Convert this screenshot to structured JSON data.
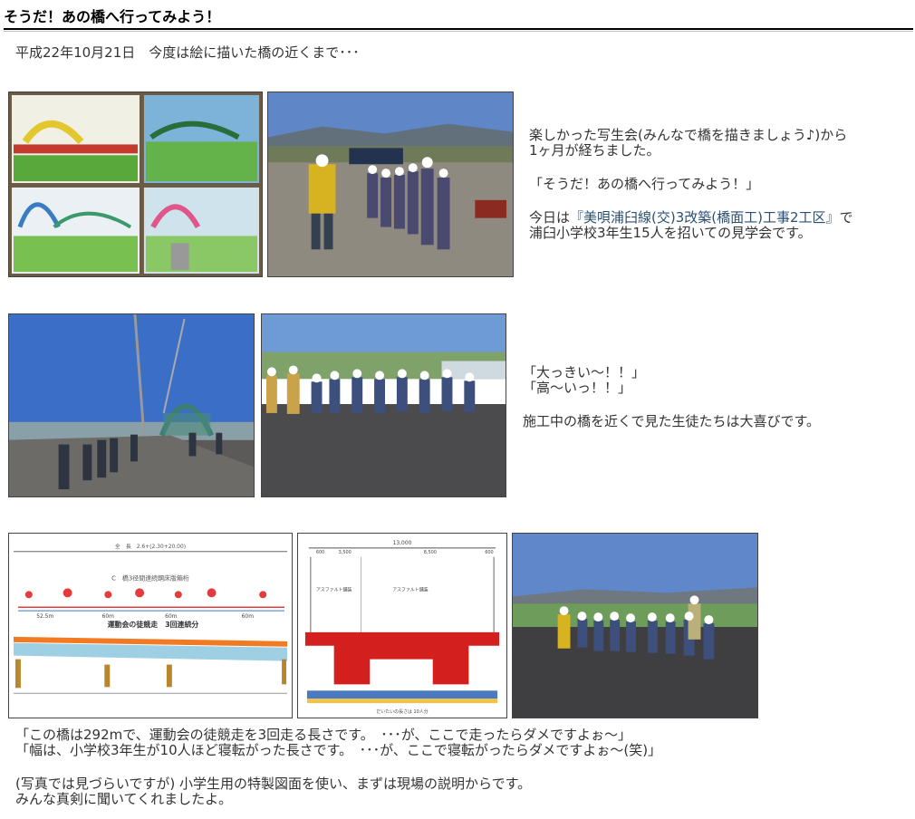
{
  "header": {
    "title": "そうだ！あの橋へ行ってみよう！"
  },
  "intro": {
    "date_line": "平成22年10月21日　今度は絵に描いた橋の近くまで･･･"
  },
  "section1": {
    "line1": "楽しかった写生会(みんなで橋を描きましょう♪)から",
    "line2": "1ヶ月が経ちました。",
    "quote": "「そうだ！あの橋へ行ってみよう！」",
    "today_prefix": "今日は",
    "project_link": "『美唄浦臼線(交)3改築(橋面工)工事2工区』",
    "today_suffix": "で",
    "line4": "浦臼小学校3年生15人を招いての見学会です。"
  },
  "section2": {
    "quote1": "「大っきい～！！」",
    "quote2": "「高～いっ！！」",
    "caption": "施工中の橋を近くで見た生徒たちは大喜びです。"
  },
  "section3": {
    "line1": "「この橋は292mで、運動会の徒競走を3回走る長さです。　･･･が、ここで走ったらダメですよぉ～」",
    "line2": "「幅は、小学校3年生が10人ほど寝転がった長さです。　･･･が、ここで寝転がったらダメですよぉ～(笑)」",
    "line3": "(写真では見づらいですが) 小学生用の特製図面を使い、まずは現場の説明からです。",
    "line4": "みんな真剣に聞いてくれましたよ。"
  },
  "diagram1": {
    "title": "C　橋3径間連続鋼床版箱桁",
    "top_dim": "全　長　2.6+(2.30+20.00)",
    "span1": "52.5m",
    "span2": "60m",
    "span3": "60m",
    "span4": "60m",
    "overlay": "運動会の徒競走　3回連続分"
  },
  "diagram2": {
    "top_total": "13,000",
    "dim_left": "3,500",
    "dim_right": "8,500",
    "dim_edge_left": "600",
    "dim_edge_right": "600",
    "label_left": "アスファルト舗装",
    "label_right": "アスファルト舗装",
    "footer": "だいたいの長さは 10人分"
  }
}
